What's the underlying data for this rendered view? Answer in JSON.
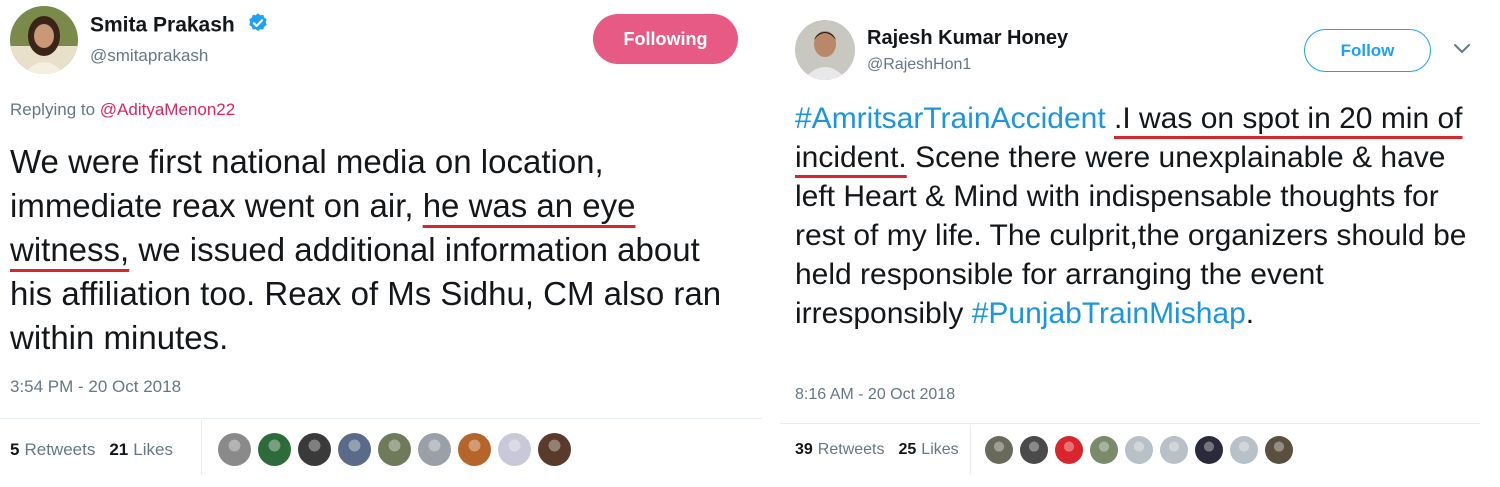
{
  "left_tweet": {
    "display_name": "Smita Prakash",
    "handle": "@smitaprakash",
    "follow_button": "Following",
    "replying_prefix": "Replying to",
    "replying_to": "@AdityaMenon22",
    "text_parts": {
      "p1": "We were first national media on location, immediate reax went on air, ",
      "underlined": "he was an eye witness,",
      "p2": " we issued additional information about his affiliation too. Reax of Ms Sidhu, CM also ran within minutes."
    },
    "timestamp": "3:54 PM - 20 Oct 2018",
    "retweets_count": "5",
    "retweets_label": "Retweets",
    "likes_count": "21",
    "likes_label": "Likes",
    "liker_colors": [
      "#8a8a8a",
      "#2e6b3a",
      "#3a3a3a",
      "#5a6b8a",
      "#6e7a5a",
      "#9aa0a8",
      "#b5652a",
      "#c8c8d8",
      "#5a3a2a"
    ]
  },
  "right_tweet": {
    "display_name": "Rajesh Kumar Honey",
    "handle": "@RajeshHon1",
    "follow_button": "Follow",
    "text_parts": {
      "hashtag1": "#AmritsarTrainAccident",
      "sp": " ",
      "underlined": ".I was on spot in 20 min of incident.",
      "p1": " Scene there were unexplainable & have left Heart & Mind with indispensable thoughts for rest of my life. The culprit,the organizers should be held responsible for arranging the event irresponsibly ",
      "hashtag2": "#PunjabTrainMishap",
      "end": "."
    },
    "timestamp": "8:16 AM - 20 Oct 2018",
    "retweets_count": "39",
    "retweets_label": "Retweets",
    "likes_count": "25",
    "likes_label": "Likes",
    "liker_colors": [
      "#6a6a5a",
      "#4a4a4a",
      "#d8262c",
      "#7a8a6a",
      "#b8c0c8",
      "#b8c0c8",
      "#2a2a3a",
      "#b8c0c8",
      "#5a5040"
    ]
  },
  "colors": {
    "link_blue": "#1da1f2",
    "following_pink": "#e0245e",
    "underline_red": "#d9262c",
    "muted_gray": "#657786"
  },
  "icons": [
    "verified-badge-icon",
    "chevron-down-icon"
  ]
}
